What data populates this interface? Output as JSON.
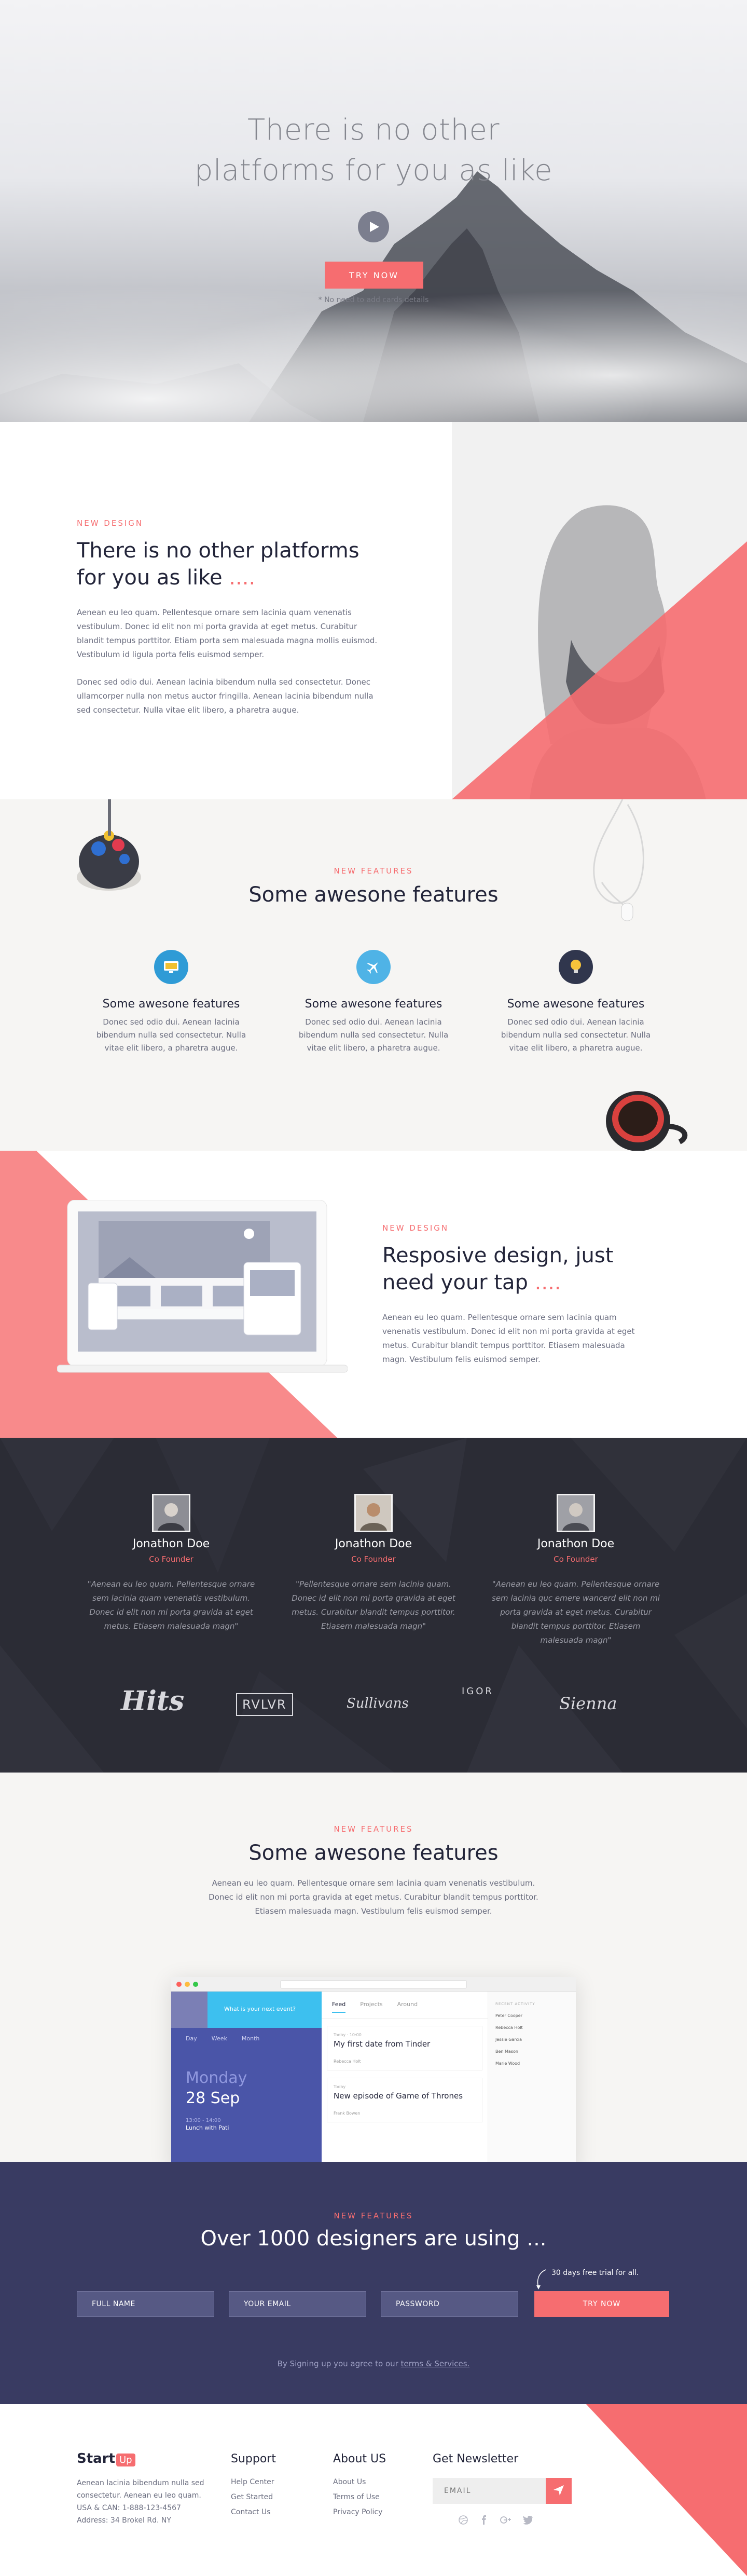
{
  "hero": {
    "title_line1": "There is no other",
    "title_line2": "platforms for you as like",
    "cta": "TRY NOW",
    "note": "* No need to add cards details"
  },
  "about": {
    "eyebrow": "NEW DESIGN",
    "title": "There is no other platforms for you as like",
    "title_dots": "....",
    "p1": "Aenean eu leo quam. Pellentesque ornare sem lacinia quam venenatis vestibulum. Donec id elit non mi porta gravida at eget metus. Curabitur blandit tempus porttitor. Etiam porta sem malesuada magna mollis euismod. Vestibulum id ligula porta felis euismod semper.",
    "p2": "Donec sed odio dui. Aenean lacinia bibendum nulla sed consectetur. Donec ullamcorper nulla non metus auctor fringilla. Aenean lacinia bibendum nulla sed consectetur. Nulla vitae elit libero, a pharetra augue."
  },
  "features": {
    "eyebrow": "NEW FEATURES",
    "title": "Some awesone features",
    "items": [
      {
        "title": "Some awesone features",
        "text": "Donec sed odio dui. Aenean lacinia bibendum nulla sed consectetur. Nulla vitae elit libero, a pharetra augue.",
        "icon": "monitor-icon",
        "color": "#2f9bd6"
      },
      {
        "title": "Some awesone features",
        "text": "Donec sed odio dui. Aenean lacinia bibendum nulla sed consectetur. Nulla vitae elit libero, a pharetra augue.",
        "icon": "airplane-icon",
        "color": "#4fb3e6"
      },
      {
        "title": "Some awesone features",
        "text": "Donec sed odio dui. Aenean lacinia bibendum nulla sed consectetur. Nulla vitae elit libero, a pharetra augue.",
        "icon": "lightbulb-icon",
        "color": "#30364d"
      }
    ]
  },
  "responsive": {
    "eyebrow": "NEW DESIGN",
    "title": "Resposive design, just need your tap",
    "title_dots": "....",
    "text": "Aenean eu leo quam. Pellentesque ornare sem lacinia quam venenatis vestibulum. Donec id elit non mi porta gravida at eget metus. Curabitur blandit tempus porttitor. Etiasem malesuada magn. Vestibulum felis euismod semper."
  },
  "team": {
    "members": [
      {
        "name": "Jonathon Doe",
        "role": "Co Founder",
        "quote": "\"Aenean eu leo quam. Pellentesque ornare sem lacinia quam venenatis vestibulum. Donec id elit non mi porta gravida at eget metus. Etiasem malesuada magn\""
      },
      {
        "name": "Jonathon Doe",
        "role": "Co Founder",
        "quote": "\"Pellentesque ornare sem lacinia quam. Donec id elit non mi porta gravida at eget metus. Curabitur blandit tempus porttitor. Etiasem malesuada magn\""
      },
      {
        "name": "Jonathon Doe",
        "role": "Co Founder",
        "quote": "\"Aenean eu leo quam. Pellentesque ornare sem lacinia quc emere wancerd elit non mi porta gravida at eget metus. Curabitur blandit tempus porttitor. Etiasem malesuada magn\""
      }
    ],
    "logos": [
      "Hits",
      "RVLVR",
      "Sullivans",
      "IGOR",
      "Sienna"
    ]
  },
  "features2": {
    "eyebrow": "NEW FEATURES",
    "title": "Some awesone features",
    "desc": "Aenean eu leo quam. Pellentesque ornare sem lacinia quam venenatis vestibulum. Donec id elit non mi porta gravida at eget metus. Curabitur blandit tempus porttitor. Etiasem malesuada magn. Vestibulum felis euismod semper.",
    "app": {
      "search_placeholder": "What is your next event?",
      "tabs": [
        "Feed",
        "Projects",
        "Around"
      ],
      "day_tabs": [
        "Day",
        "Week",
        "Month"
      ],
      "date_month": "Monday",
      "date_day": "28 Sep",
      "event_time": "13:00 - 14:00",
      "event_name": "Lunch with Pati",
      "posts": [
        {
          "label": "Today · 10:00",
          "title": "My first date from Tinder",
          "author": "Rebecca Holt"
        },
        {
          "label": "Today",
          "title": "New episode of Game of Thrones",
          "author": "Frank Bowen"
        }
      ],
      "side_title": "RECENT ACTIVITY",
      "people": [
        "Peter Cooper",
        "Rebecca Holt",
        "Jessie Garcia",
        "Ben Mason",
        "Marie Wood"
      ]
    }
  },
  "signup": {
    "eyebrow": "NEW FEATURES",
    "title": "Over 1000 designers are using ...",
    "trial": "30 days free trial for all.",
    "name_ph": "FULL NAME",
    "email_ph": "YOUR EMAIL",
    "pass_ph": "PASSWORD",
    "button": "TRY NOW",
    "terms_prefix": "By Signing up you agree to our",
    "terms_link": "terms & Services."
  },
  "footer": {
    "brand": "Start",
    "brand_suffix": "Up",
    "desc": "Aenean lacinia bibendum nulla sed consectetur. Aenean eu leo quam.",
    "phone": "USA & CAN: 1-888-123-4567",
    "address": "Address: 34 Brokel Rd. NY",
    "support_title": "Support",
    "support_links": [
      "Help Center",
      "Get Started",
      "Contact Us"
    ],
    "about_title": "About US",
    "about_links": [
      "About Us",
      "Terms of Use",
      "Privacy Policy"
    ],
    "newsletter_title": "Get Newsletter",
    "email_ph": "EMAIL",
    "socials": [
      "dribbble-icon",
      "facebook-icon",
      "google-plus-icon",
      "twitter-icon"
    ]
  },
  "colors": {
    "accent": "#f66d70",
    "navy": "#393b62",
    "dark": "#2b2c35",
    "cream": "#f6f5f3"
  }
}
